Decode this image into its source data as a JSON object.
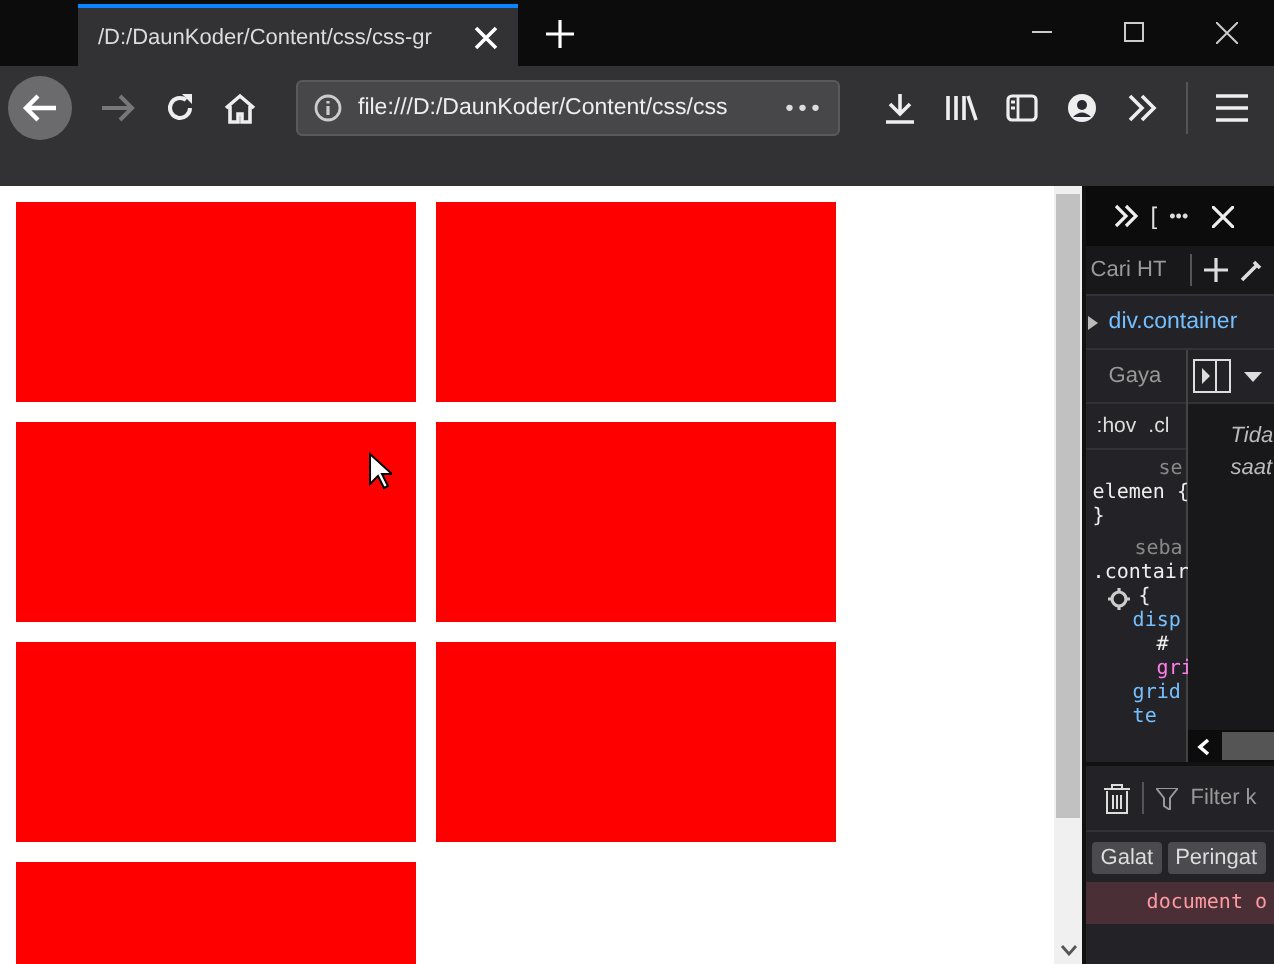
{
  "tab": {
    "title": "/D:/DaunKoder/Content/css/css-gr",
    "selected": true
  },
  "address": {
    "url": "file:///D:/DaunKoder/Content/css/css",
    "more": "•••"
  },
  "page": {
    "boxes": [
      {
        "color": "#ff0000"
      },
      {
        "color": "#ff0000"
      },
      {
        "color": "#ff0000"
      },
      {
        "color": "#ff0000"
      },
      {
        "color": "#ff0000"
      },
      {
        "color": "#ff0000"
      },
      {
        "color": "#ff0000"
      }
    ]
  },
  "devtools": {
    "top": [
      "[",
      "•••"
    ],
    "search_placeholder": "Cari HT",
    "breadcrumb": "div.container",
    "rules_filter_placeholder": "Gaya",
    "pseudo": [
      ":hov",
      ".cl"
    ],
    "rules": [
      {
        "kind": "comment",
        "text": "se"
      },
      {
        "kind": "code",
        "text": "elemen {"
      },
      {
        "kind": "code",
        "text": "}"
      },
      {
        "kind": "comment",
        "text": "seba"
      },
      {
        "kind": "code",
        "text": ".contair"
      },
      {
        "kind": "gear",
        "text": "{"
      },
      {
        "kind": "prop",
        "text": "disp"
      },
      {
        "kind": "grid",
        "text": "#"
      },
      {
        "kind": "value",
        "text": "gri"
      },
      {
        "kind": "prop",
        "text": "grid"
      },
      {
        "kind": "prop",
        "text": "te"
      }
    ],
    "side_note": [
      "Tida",
      "saat"
    ],
    "console": {
      "filter_placeholder": "Filter k",
      "levels": [
        {
          "label": "Galat",
          "selected": true
        },
        {
          "label": "Peringat",
          "selected": true
        }
      ],
      "message": "document o"
    }
  }
}
